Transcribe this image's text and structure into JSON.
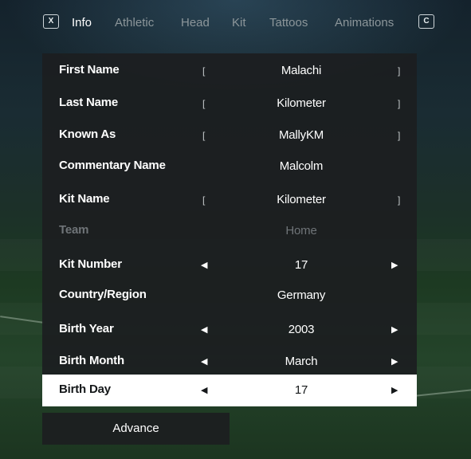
{
  "tabs": {
    "left_key": "X",
    "right_key": "C",
    "items": [
      "Info",
      "Athletic",
      "Head",
      "Kit",
      "Tattoos",
      "Animations"
    ],
    "active": "Info"
  },
  "fields": [
    {
      "label": "First Name",
      "value": "Malachi",
      "control": "text"
    },
    {
      "label": "Last Name",
      "value": "Kilometer",
      "control": "text"
    },
    {
      "label": "Known As",
      "value": "MallyKM",
      "control": "text"
    },
    {
      "label": "Commentary Name",
      "value": "Malcolm",
      "control": "none"
    },
    {
      "label": "Kit Name",
      "value": "Kilometer",
      "control": "text"
    },
    {
      "label": "Team",
      "value": "Home",
      "control": "disabled"
    },
    {
      "label": "Kit Number",
      "value": "17",
      "control": "arrows"
    },
    {
      "label": "Country/Region",
      "value": "Germany",
      "control": "none"
    },
    {
      "label": "Birth Year",
      "value": "2003",
      "control": "arrows"
    },
    {
      "label": "Birth Month",
      "value": "March",
      "control": "arrows"
    },
    {
      "label": "Birth Day",
      "value": "17",
      "control": "arrows",
      "selected": true
    }
  ],
  "glyphs": {
    "bracket_open": "[",
    "bracket_close": "]",
    "arrow_left": "◀",
    "arrow_right": "▶"
  },
  "advance_label": "Advance",
  "colors": {
    "selected_row": "#ffffff",
    "panel": "#1c1e20",
    "disabled_text": "#6f7478"
  }
}
